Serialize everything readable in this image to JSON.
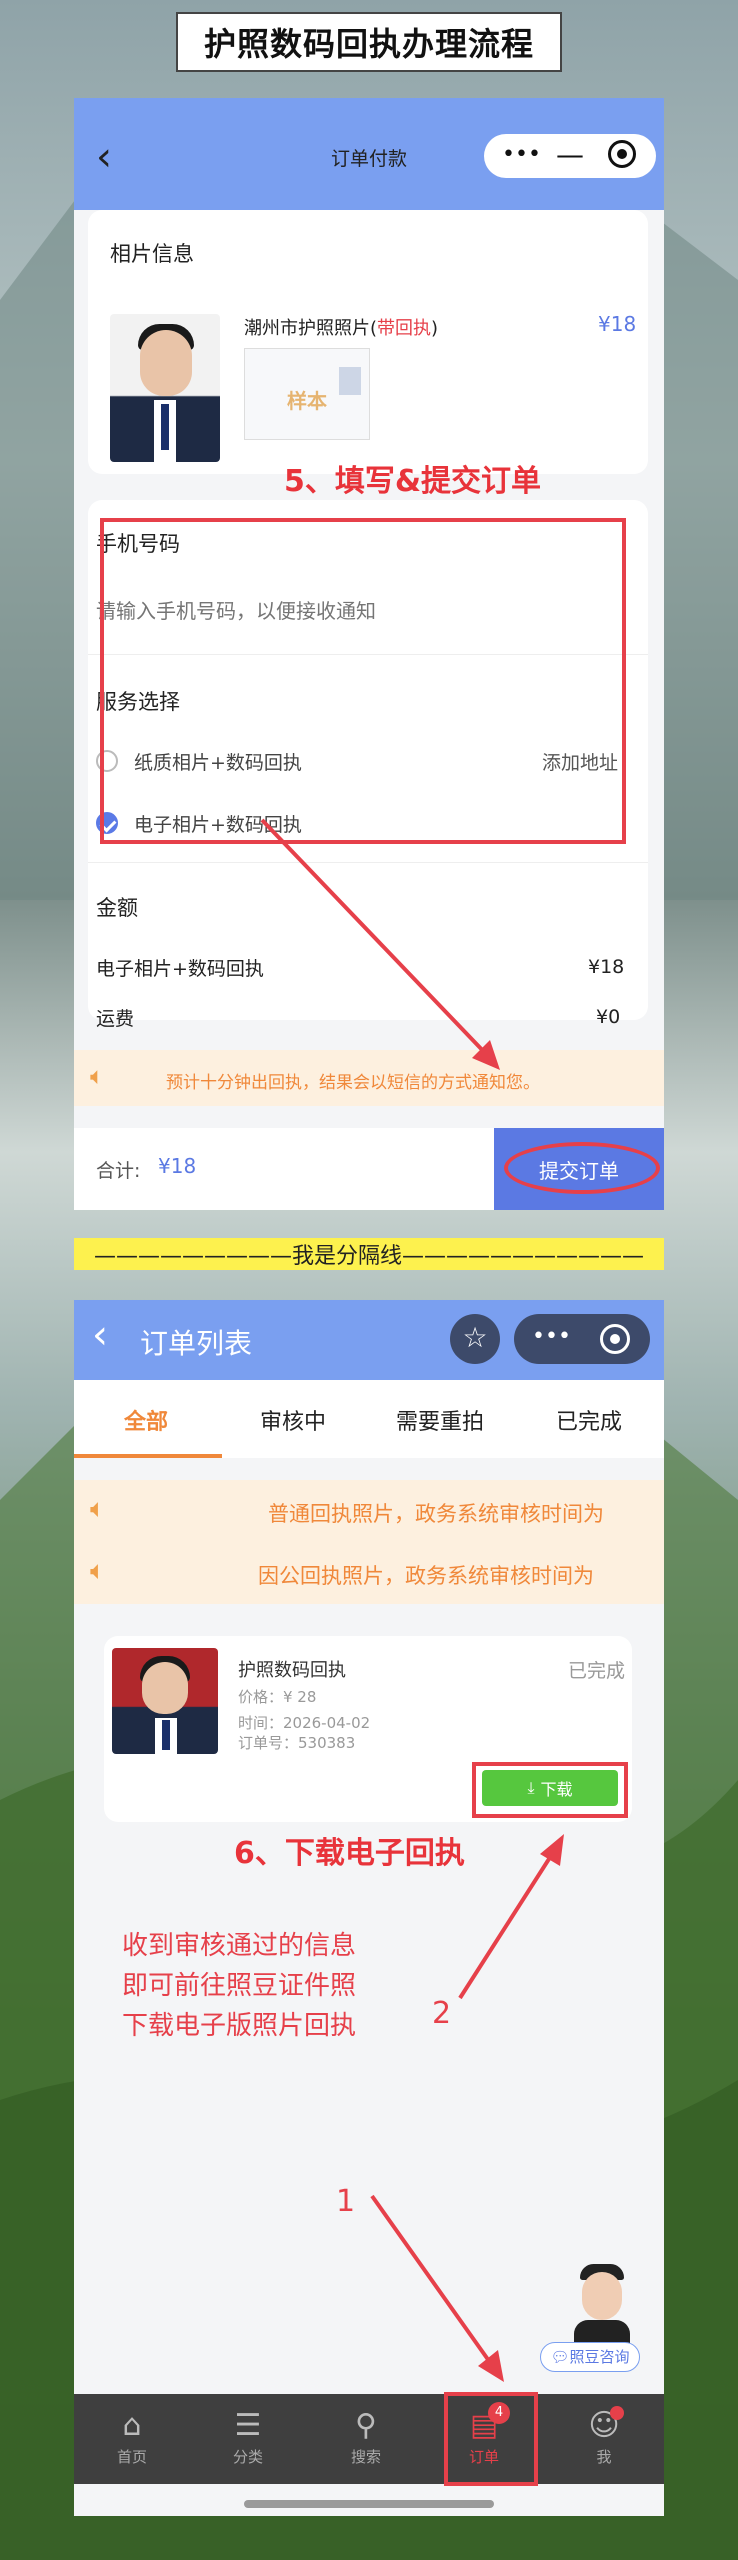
{
  "header": {
    "title": "护照数码回执办理流程"
  },
  "screen1": {
    "nav_title": "订单付款",
    "back_icon": "chevron-left-icon",
    "photo_section_label": "相片信息",
    "product_name": "潮州市护照照片",
    "product_tag": "带回执",
    "product_price": "¥18",
    "sample_stamp": "样本",
    "annotation_step5": "5、填写&提交订单",
    "phone_label": "手机号码",
    "phone_placeholder": "请输入手机号码，以便接收通知",
    "service_label": "服务选择",
    "option1": "纸质相片+数码回执",
    "option1_action": "添加地址",
    "option2": "电子相片+数码回执",
    "amount_label": "金额",
    "amount_item": "电子相片+数码回执",
    "amount_item_price": "¥18",
    "shipping_label": "运费",
    "shipping_price": "¥0",
    "notice": "预计十分钟出回执，结果会以短信的方式通知您。",
    "total_label": "合计:",
    "total_value": "¥18",
    "submit_label": "提交订单"
  },
  "separator": "—————————我是分隔线———————————",
  "screen2": {
    "nav_title": "订单列表",
    "tabs": [
      "全部",
      "审核中",
      "需要重拍",
      "已完成"
    ],
    "notice1": "普通回执照片，政务系统审核时间为",
    "notice2": "因公回执照片，政务系统审核时间为",
    "order": {
      "title": "护照数码回执",
      "status": "已完成",
      "price": "价格：¥ 28",
      "time": "时间：2026-04-02",
      "order_no": "订单号：530383",
      "download_label": "下载"
    },
    "annotation_step6": "6、下载电子回执",
    "annotation_text": [
      "收到审核通过的信息",
      "即可前往照豆证件照",
      "下载电子版照片回执"
    ],
    "annotation_num1": "1",
    "annotation_num2": "2",
    "consult_label": "照豆咨询",
    "tabbar": [
      {
        "label": "首页",
        "icon": "home-icon"
      },
      {
        "label": "分类",
        "icon": "category-icon"
      },
      {
        "label": "搜索",
        "icon": "search-icon"
      },
      {
        "label": "订单",
        "icon": "order-icon",
        "badge": "4"
      },
      {
        "label": "我",
        "icon": "user-icon"
      }
    ]
  },
  "colors": {
    "accent": "#7a9ff0",
    "primary": "#5b79e3",
    "annotation_red": "#e6404a",
    "orange": "#f0883a",
    "green": "#56c73e"
  }
}
